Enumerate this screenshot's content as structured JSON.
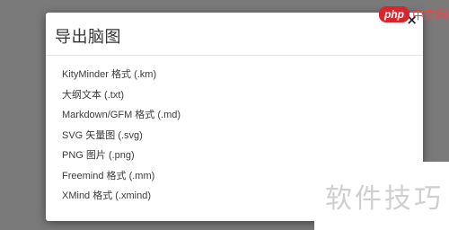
{
  "modal": {
    "title": "导出脑图",
    "close_label": "×"
  },
  "formats": [
    "KityMinder 格式 (.km)",
    "大纲文本 (.txt)",
    "Markdown/GFM 格式 (.md)",
    "SVG 矢量图 (.svg)",
    "PNG 图片 (.png)",
    "Freemind 格式 (.mm)",
    "XMind 格式 (.xmind)"
  ],
  "watermarks": {
    "site_logo": "php",
    "site_cn": "中文网",
    "corner_text": "软件技巧"
  }
}
